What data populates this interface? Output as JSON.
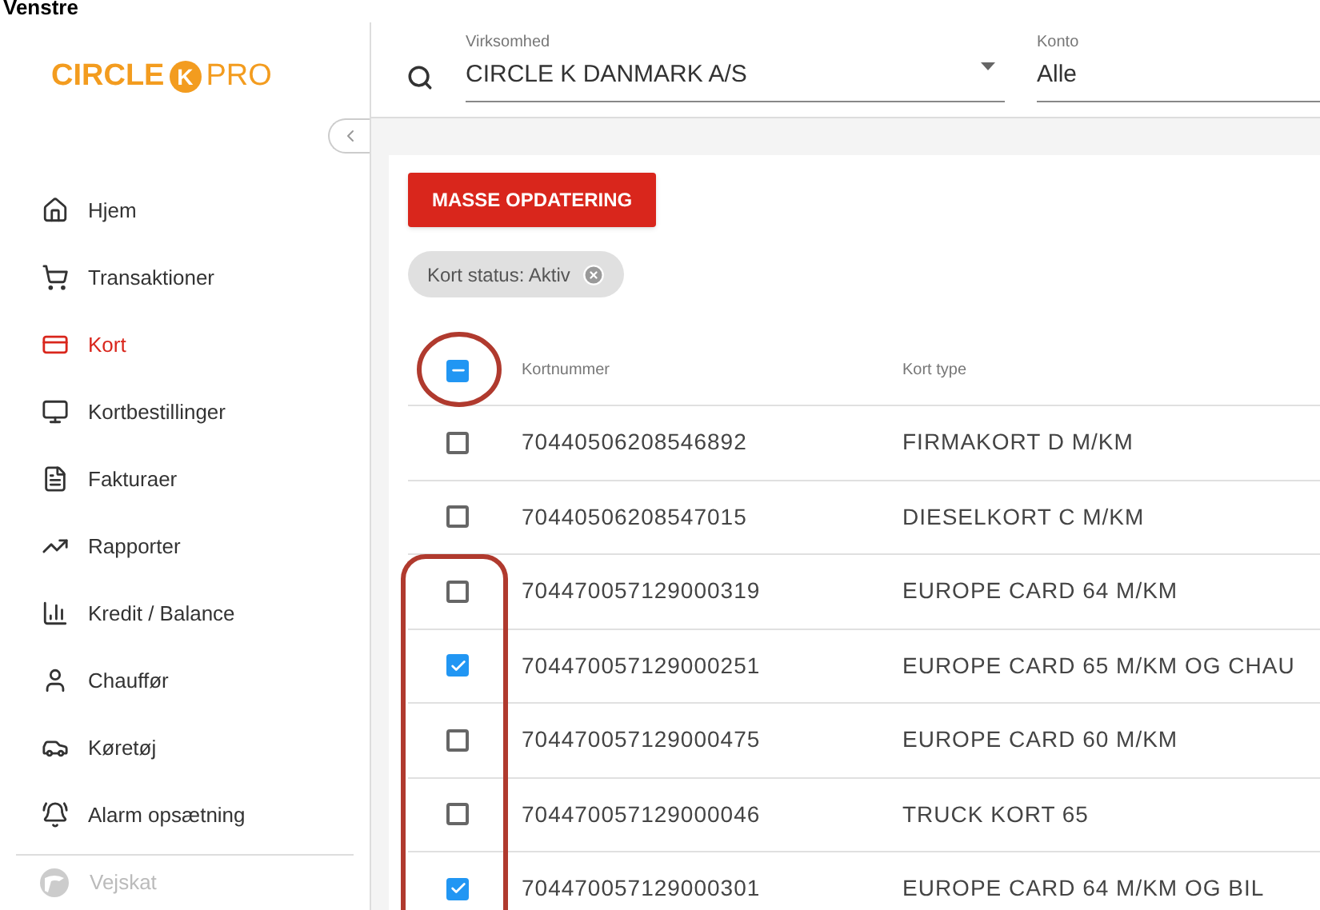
{
  "caption": "Venstre",
  "sidebar": {
    "logo": {
      "brand": "CIRCLE",
      "letter": "K",
      "suffix": "PRO"
    },
    "items": [
      {
        "label": "Hjem",
        "selected": false,
        "disabled": false
      },
      {
        "label": "Transaktioner",
        "selected": false,
        "disabled": false
      },
      {
        "label": "Kort",
        "selected": true,
        "disabled": false
      },
      {
        "label": "Kortbestillinger",
        "selected": false,
        "disabled": false
      },
      {
        "label": "Fakturaer",
        "selected": false,
        "disabled": false
      },
      {
        "label": "Rapporter",
        "selected": false,
        "disabled": false
      },
      {
        "label": "Kredit / Balance",
        "selected": false,
        "disabled": false
      },
      {
        "label": "Chauffør",
        "selected": false,
        "disabled": false
      },
      {
        "label": "Køretøj",
        "selected": false,
        "disabled": false
      },
      {
        "label": "Alarm opsætning",
        "selected": false,
        "disabled": false
      }
    ],
    "footer_item": {
      "label": "Vejskat",
      "disabled": true
    }
  },
  "header": {
    "company": {
      "label": "Virksomhed",
      "value": "CIRCLE K DANMARK A/S"
    },
    "account": {
      "label": "Konto",
      "value": "Alle"
    }
  },
  "bulk_button": "MASSE OPDATERING",
  "filter_chip": "Kort status: Aktiv",
  "table": {
    "select_all": {
      "indeterminate": true
    },
    "columns": [
      "Kortnummer",
      "Kort type"
    ],
    "rows": [
      {
        "number": "70440506208546892",
        "type": "FIRMAKORT D M/KM",
        "checked": false
      },
      {
        "number": "70440506208547015",
        "type": "DIESELKORT C M/KM",
        "checked": false
      },
      {
        "number": "704470057129000319",
        "type": "EUROPE CARD 64 M/KM",
        "checked": false
      },
      {
        "number": "704470057129000251",
        "type": "EUROPE CARD 65 M/KM OG CHAU",
        "checked": true
      },
      {
        "number": "704470057129000475",
        "type": "EUROPE CARD 60 M/KM",
        "checked": false
      },
      {
        "number": "704470057129000046",
        "type": "TRUCK KORT 65",
        "checked": false
      },
      {
        "number": "704470057129000301",
        "type": "EUROPE CARD 64 M/KM OG BIL",
        "checked": true
      }
    ]
  }
}
